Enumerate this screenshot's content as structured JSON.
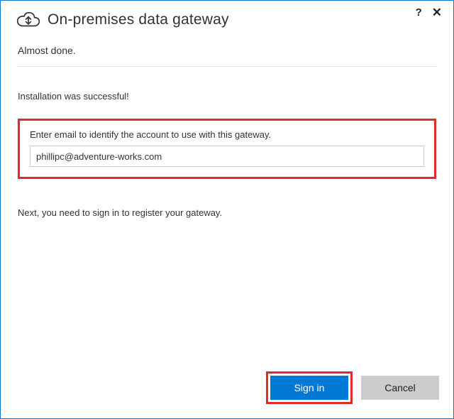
{
  "title": "On-premises data gateway",
  "subtitle": "Almost done.",
  "success_message": "Installation was successful!",
  "email_section": {
    "label": "Enter email to identify the account to use with this gateway.",
    "value": "phillipc@adventure-works.com"
  },
  "next_message": "Next, you need to sign in to register your gateway.",
  "buttons": {
    "sign_in": "Sign in",
    "cancel": "Cancel"
  },
  "titlebar": {
    "help": "?",
    "close": "✕"
  }
}
